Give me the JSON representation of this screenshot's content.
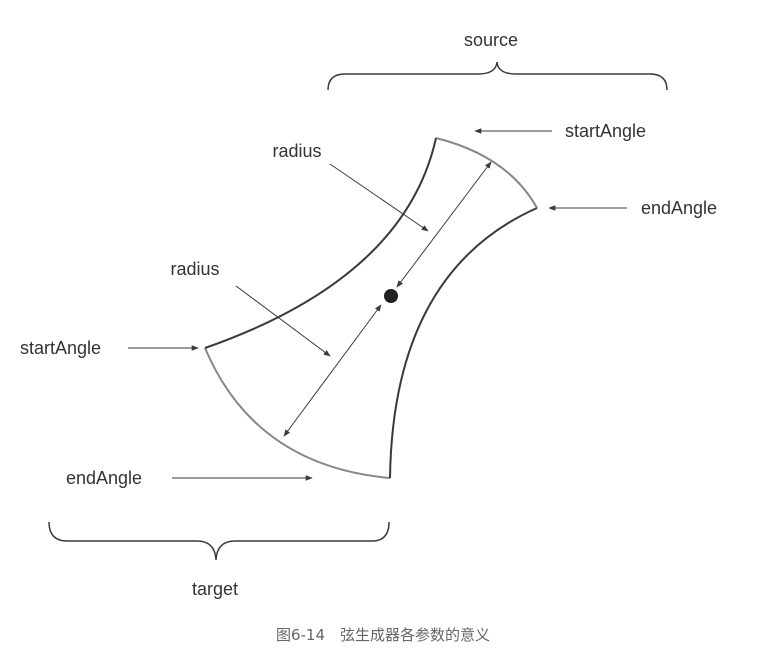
{
  "labels": {
    "source": "source",
    "target": "target",
    "source_start_angle": "startAngle",
    "source_end_angle": "endAngle",
    "target_start_angle": "startAngle",
    "target_end_angle": "endAngle",
    "source_radius": "radius",
    "target_radius": "radius"
  },
  "caption": "图6-14　弦生成器各参数的意义",
  "colors": {
    "background": "#ffffff",
    "stroke_dark": "#3a3a3a",
    "stroke_light": "#888888",
    "text": "#333333",
    "caption_text": "#666666"
  }
}
